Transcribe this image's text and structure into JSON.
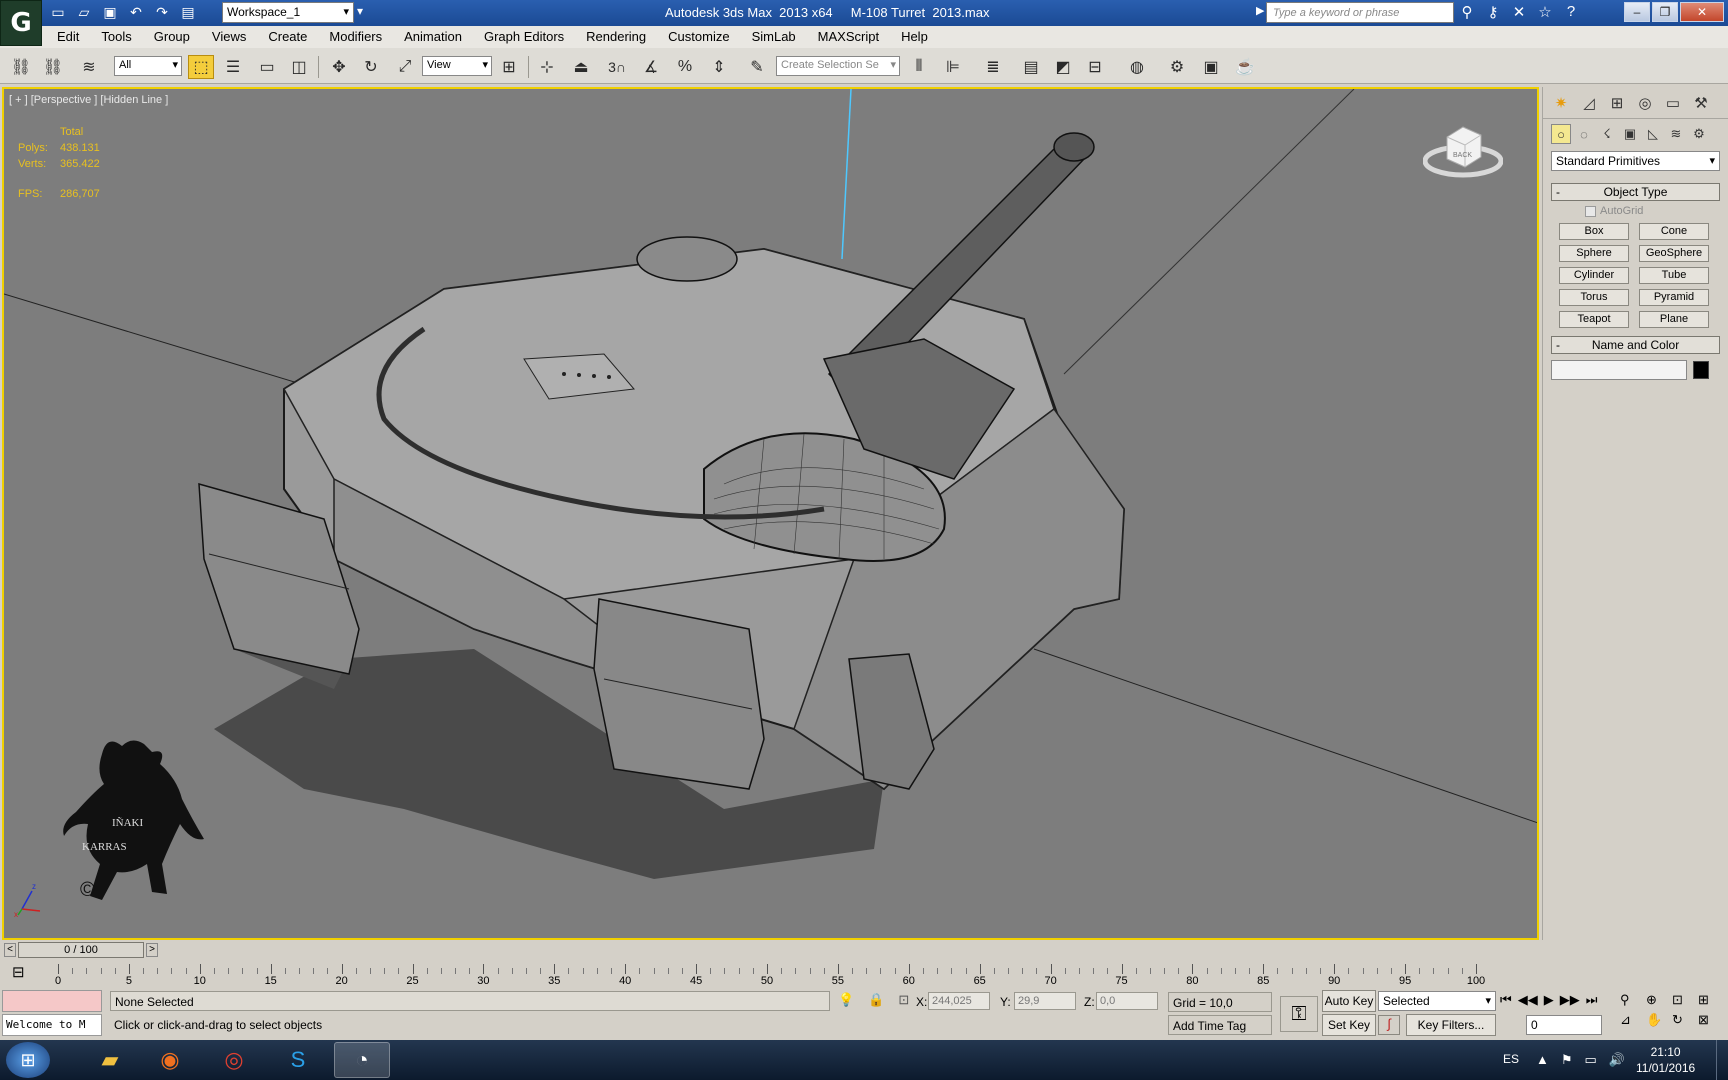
{
  "title_bar": {
    "app_title": "Autodesk 3ds Max  2013 x64",
    "file_name": "M-108 Turret  2013.max",
    "workspace": "Workspace_1",
    "search_placeholder": "Type a keyword or phrase",
    "app_logo_glyph": "G"
  },
  "menu": [
    "Edit",
    "Tools",
    "Group",
    "Views",
    "Create",
    "Modifiers",
    "Animation",
    "Graph Editors",
    "Rendering",
    "Customize",
    "SimLab",
    "MAXScript",
    "Help"
  ],
  "toolbar": {
    "selection_filter": "All",
    "reference_coord": "View",
    "named_selection_placeholder": "Create Selection Se",
    "snap_3": "3"
  },
  "viewport": {
    "label": "[ + ] [Perspective ] [Hidden Line ]",
    "stats_header": "Total",
    "polys_label": "Polys:",
    "polys_value": "438.131",
    "verts_label": "Verts:",
    "verts_value": "365.422",
    "fps_label": "FPS:",
    "fps_value": "286,707",
    "viewcube_label": "BACK",
    "watermark_line1": "IÑAKI",
    "watermark_line2": "KARRAS",
    "watermark_copyright": "©",
    "axis_z": "z",
    "axis_x": "x",
    "accent_color": "#f0d000",
    "background_color": "#7d7d7d"
  },
  "command_panel": {
    "category": "Standard Primitives",
    "object_type_title": "Object Type",
    "autogrid_label": "AutoGrid",
    "primitives": [
      "Box",
      "Cone",
      "Sphere",
      "GeoSphere",
      "Cylinder",
      "Tube",
      "Torus",
      "Pyramid",
      "Teapot",
      "Plane"
    ],
    "name_color_title": "Name and Color"
  },
  "time_slider": {
    "position": "0 / 100",
    "prev": "<",
    "next": ">"
  },
  "track_bar": {
    "ticks": [
      "0",
      "5",
      "10",
      "15",
      "20",
      "25",
      "30",
      "35",
      "40",
      "45",
      "50",
      "55",
      "60",
      "65",
      "70",
      "75",
      "80",
      "85",
      "90",
      "95",
      "100"
    ]
  },
  "status_bar": {
    "welcome": "Welcome to M",
    "selection": "None Selected",
    "prompt": "Click or click-and-drag to select objects",
    "x_label": "X:",
    "x_value": "244,025",
    "y_label": "Y:",
    "y_value": "29,9",
    "z_label": "Z:",
    "z_value": "0,0",
    "grid": "Grid = 10,0",
    "add_time_tag": "Add Time Tag",
    "auto_key": "Auto Key",
    "set_key": "Set Key",
    "key_mode": "Selected",
    "key_filters": "Key Filters...",
    "current_frame": "0"
  },
  "taskbar": {
    "language": "ES",
    "time": "21:10",
    "date": "11/01/2016"
  }
}
